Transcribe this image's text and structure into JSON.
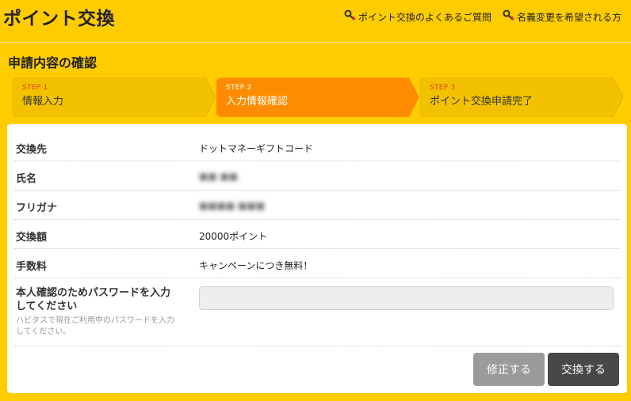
{
  "header": {
    "title": "ポイント交換",
    "links": [
      {
        "label": "ポイント交換のよくあるご質問",
        "icon": "key-icon"
      },
      {
        "label": "名義変更を希望される方",
        "icon": "key-icon"
      }
    ]
  },
  "section_title": "申請内容の確認",
  "steps": [
    {
      "num": "STEP 1",
      "label": "情報入力",
      "active": false
    },
    {
      "num": "STEP 2",
      "label": "入力情報確認",
      "active": true
    },
    {
      "num": "STEP 3",
      "label": "ポイント交換申請完了",
      "active": false
    }
  ],
  "rows": [
    {
      "label": "交換先",
      "value": "ドットマネーギフトコード"
    },
    {
      "label": "氏名",
      "value": "■■ ■■"
    },
    {
      "label": "フリガナ",
      "value": "■■■■ ■■■"
    },
    {
      "label": "交換額",
      "value": "20000ポイント"
    },
    {
      "label": "手数料",
      "value": "キャンペーンにつき無料！"
    }
  ],
  "password": {
    "label": "本人確認のためパスワードを入力してください",
    "hint": "ハピタスで現在ご利用中のパスワードを入力してください。",
    "placeholder": ""
  },
  "buttons": {
    "edit": "修正する",
    "exchange": "交換する"
  },
  "colors": {
    "background": "#ffcc00",
    "step_active": "#ff8c00",
    "step_inactive": "#f2c200",
    "step_number": "#e8410a",
    "edit_button": "#9b9b9b",
    "exchange_button": "#484848"
  }
}
